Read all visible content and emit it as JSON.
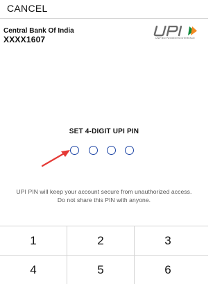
{
  "header": {
    "cancel_label": "CANCEL"
  },
  "account": {
    "bank_name": "Central Bank Of India",
    "masked_number": "XXXX1607"
  },
  "logo": {
    "tagline": "UNIFIED PAYMENTS INTERFACE"
  },
  "pin": {
    "title": "SET 4-DIGIT UPI PIN",
    "digits_entered": 0,
    "digits_total": 4
  },
  "info": {
    "line1": "UPI PIN will keep your account secure from unauthorized access.",
    "line2": "Do not share this PIN with anyone."
  },
  "keypad": {
    "k1": "1",
    "k2": "2",
    "k3": "3",
    "k4": "4",
    "k5": "5",
    "k6": "6"
  },
  "colors": {
    "pin_circle": "#1f47a6",
    "annotation_arrow": "#e53935",
    "logo_grey": "#6a6a6a",
    "logo_green": "#0f8a3c",
    "logo_orange": "#f28a22"
  }
}
